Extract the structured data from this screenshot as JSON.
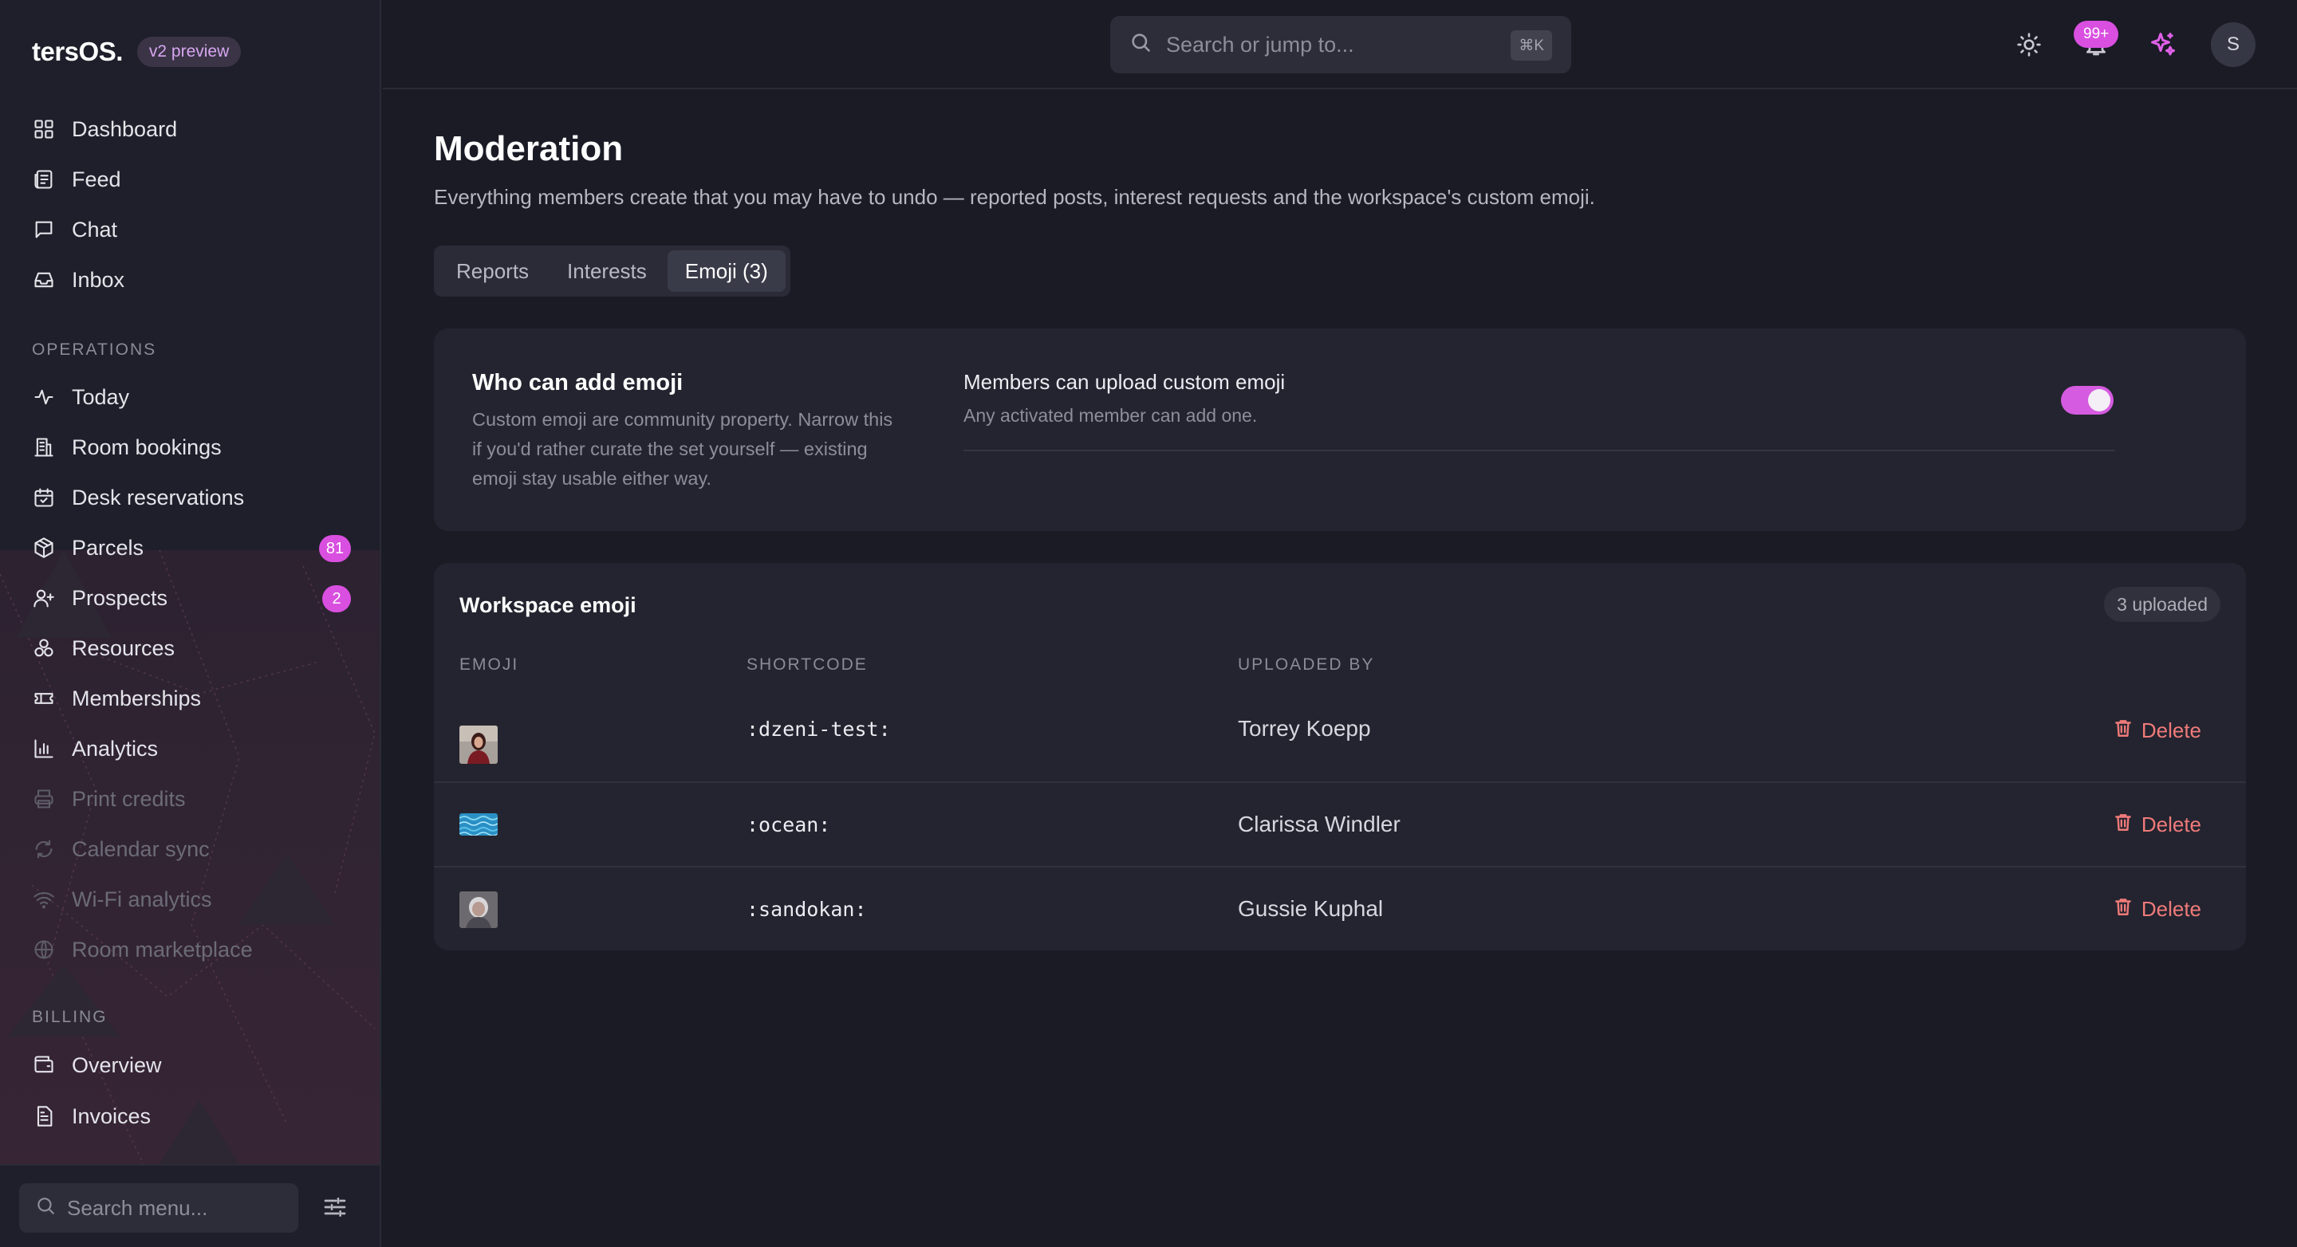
{
  "brand": {
    "name": "tersOS.",
    "badge": "v2 preview"
  },
  "sidebar": {
    "main_items": [
      {
        "label": "Dashboard",
        "icon": "grid-icon"
      },
      {
        "label": "Feed",
        "icon": "newspaper-icon"
      },
      {
        "label": "Chat",
        "icon": "chat-bubble-icon"
      },
      {
        "label": "Inbox",
        "icon": "inbox-icon"
      }
    ],
    "operations_label": "OPERATIONS",
    "operations_items": [
      {
        "label": "Today",
        "icon": "activity-icon"
      },
      {
        "label": "Room bookings",
        "icon": "building-icon"
      },
      {
        "label": "Desk reservations",
        "icon": "calendar-check-icon"
      },
      {
        "label": "Parcels",
        "icon": "package-icon",
        "badge": "81"
      },
      {
        "label": "Prospects",
        "icon": "user-plus-icon",
        "badge": "2"
      },
      {
        "label": "Resources",
        "icon": "resources-icon"
      },
      {
        "label": "Memberships",
        "icon": "ticket-icon"
      },
      {
        "label": "Analytics",
        "icon": "bar-chart-icon"
      },
      {
        "label": "Print credits",
        "icon": "printer-icon",
        "disabled": true
      },
      {
        "label": "Calendar sync",
        "icon": "refresh-icon",
        "disabled": true
      },
      {
        "label": "Wi-Fi analytics",
        "icon": "wifi-icon",
        "disabled": true
      },
      {
        "label": "Room marketplace",
        "icon": "globe-icon",
        "disabled": true
      }
    ],
    "billing_label": "BILLING",
    "billing_items": [
      {
        "label": "Overview",
        "icon": "wallet-icon"
      },
      {
        "label": "Invoices",
        "icon": "document-icon"
      }
    ],
    "menu_search_placeholder": "Search menu..."
  },
  "topbar": {
    "search_placeholder": "Search or jump to...",
    "search_shortcut": "⌘K",
    "notification_count": "99+",
    "avatar_initial": "S"
  },
  "page": {
    "title": "Moderation",
    "subtitle": "Everything members create that you may have to undo — reported posts, interest requests and the workspace's custom emoji.",
    "tabs": [
      {
        "label": "Reports",
        "active": false
      },
      {
        "label": "Interests",
        "active": false
      },
      {
        "label": "Emoji (3)",
        "active": true
      }
    ]
  },
  "settings": {
    "title": "Who can add emoji",
    "description": "Custom emoji are community property. Narrow this if you'd rather curate the set yourself — existing emoji stay usable either way.",
    "toggle_label": "Members can upload custom emoji",
    "toggle_help": "Any activated member can add one.",
    "toggle_on": true
  },
  "emoji_table": {
    "title": "Workspace emoji",
    "count_label": "3 uploaded",
    "columns": [
      "EMOJI",
      "SHORTCODE",
      "UPLOADED BY"
    ],
    "delete_label": "Delete",
    "rows": [
      {
        "shortcode": ":dzeni-test:",
        "uploaded_by": "Torrey Koepp",
        "thumb": "portrait-woman"
      },
      {
        "shortcode": ":ocean:",
        "uploaded_by": "Clarissa Windler",
        "thumb": "ocean-water"
      },
      {
        "shortcode": ":sandokan:",
        "uploaded_by": "Gussie Kuphal",
        "thumb": "portrait-grey"
      }
    ]
  },
  "colors": {
    "accent": "#d94fe0",
    "danger": "#f07a7a",
    "background": "#1a1b25",
    "card": "#23242f"
  }
}
